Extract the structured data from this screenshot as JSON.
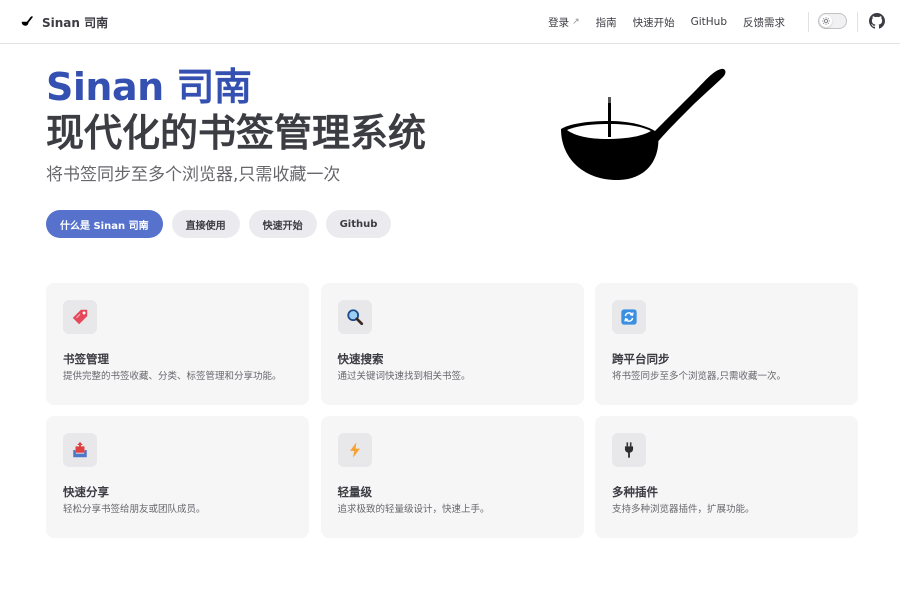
{
  "nav": {
    "title": "Sinan 司南",
    "links": [
      {
        "label": "登录",
        "external": true
      },
      {
        "label": "指南",
        "external": false
      },
      {
        "label": "快速开始",
        "external": false
      },
      {
        "label": "GitHub",
        "external": false
      },
      {
        "label": "反馈需求",
        "external": false
      }
    ],
    "icons": [
      "spoon-logo-icon",
      "external-link-icon",
      "sun-icon",
      "github-icon"
    ]
  },
  "hero": {
    "name": "Sinan 司南",
    "text": "现代化的书签管理系统",
    "tagline": "将书签同步至多个浏览器,只需收藏一次",
    "actions": [
      {
        "label": "什么是 Sinan 司南",
        "theme": "brand"
      },
      {
        "label": "直接使用",
        "theme": "alt"
      },
      {
        "label": "快速开始",
        "theme": "alt"
      },
      {
        "label": "Github",
        "theme": "alt"
      }
    ],
    "image": "sinan-spoon-icon"
  },
  "features": [
    {
      "icon": "bookmark-tag-icon",
      "title": "书签管理",
      "details": "提供完整的书签收藏、分类、标签管理和分享功能。"
    },
    {
      "icon": "magnifier-icon",
      "title": "快速搜索",
      "details": "通过关键词快速找到相关书签。"
    },
    {
      "icon": "sync-icon",
      "title": "跨平台同步",
      "details": "将书签同步至多个浏览器,只需收藏一次。"
    },
    {
      "icon": "share-tray-icon",
      "title": "快速分享",
      "details": "轻松分享书签给朋友或团队成员。"
    },
    {
      "icon": "lightning-icon",
      "title": "轻量级",
      "details": "追求极致的轻量级设计，快速上手。"
    },
    {
      "icon": "plug-icon",
      "title": "多种插件",
      "details": "支持多种浏览器插件，扩展功能。"
    }
  ],
  "colors": {
    "brand": "#3451b2",
    "brand_button": "#5672cd",
    "text": "#3c3c43",
    "muted": "#67676c",
    "card": "#f6f6f7"
  }
}
